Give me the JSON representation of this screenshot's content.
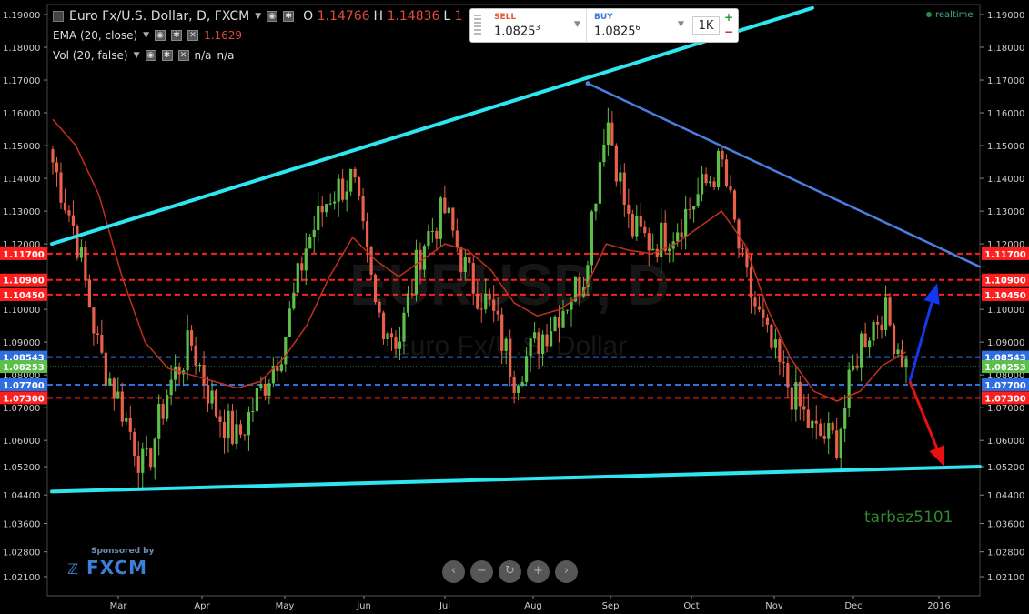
{
  "header": {
    "title": "Euro Fx/U.S. Dollar, D, FXCM",
    "ohlc": [
      {
        "key": "O",
        "value": "1.14766"
      },
      {
        "key": "H",
        "value": "1.14836"
      },
      {
        "key": "L",
        "value": "1"
      }
    ]
  },
  "indicators": {
    "ema_label": "EMA (20, close)",
    "ema_value": "1.1629",
    "vol_label": "Vol (20, false)",
    "vol_value1": "n/a",
    "vol_value2": "n/a"
  },
  "trade": {
    "sell_label": "SELL",
    "sell_price": "1.0825",
    "sell_pip": "3",
    "buy_label": "BUY",
    "buy_price": "1.0825",
    "buy_pip": "6",
    "quantity": "1K",
    "plus": "+",
    "minus": "−"
  },
  "status": {
    "realtime": "realtime"
  },
  "sponsor": {
    "label": "Sponsored by",
    "brand": "FXCM"
  },
  "watermark": {
    "line1": "EURUSD, D",
    "line2": "Euro Fx/U.S. Dollar"
  },
  "signature": "tarbaz5101",
  "nav_icons": [
    "chevron-left-icon",
    "zoom-out-icon",
    "reset-icon",
    "zoom-in-icon",
    "chevron-right-icon"
  ],
  "colors": {
    "up": "#5cbf4a",
    "down": "#e8604a",
    "ema": "#c0301e",
    "trendline": "#2ee6f0",
    "resistance_line": "#4a7fe0",
    "level_red": "#ff1f1f",
    "level_blue": "#2f6ee0"
  },
  "chart_data": {
    "type": "candlestick",
    "symbol": "EURUSD",
    "timeframe": "D",
    "ylim": [
      1.016,
      1.192
    ],
    "y_ticks": [
      "1.19000",
      "1.18000",
      "1.17000",
      "1.16000",
      "1.15000",
      "1.14000",
      "1.13000",
      "1.12000",
      "1.11000",
      "1.10000",
      "1.09000",
      "1.08000",
      "1.07000",
      "1.06000",
      "1.05200",
      "1.04400",
      "1.03600",
      "1.02800",
      "1.02100"
    ],
    "x_ticks": [
      "Mar",
      "Apr",
      "May",
      "Jun",
      "Jul",
      "Aug",
      "Sep",
      "Oct",
      "Nov",
      "Dec",
      "2016"
    ],
    "price_path": [
      [
        "Feb",
        1.145
      ],
      [
        "Mar",
        1.123
      ],
      [
        "Mar",
        1.087
      ],
      [
        "Mar",
        1.07
      ],
      [
        "Mar",
        1.05
      ],
      [
        "Apr",
        1.076
      ],
      [
        "Apr",
        1.09
      ],
      [
        "Apr",
        1.07
      ],
      [
        "Apr",
        1.06
      ],
      [
        "Apr",
        1.075
      ],
      [
        "May",
        1.09
      ],
      [
        "May",
        1.12
      ],
      [
        "May",
        1.135
      ],
      [
        "May",
        1.14
      ],
      [
        "Jun",
        1.1
      ],
      [
        "Jun",
        1.09
      ],
      [
        "Jun",
        1.12
      ],
      [
        "Jun",
        1.13
      ],
      [
        "Jul",
        1.11
      ],
      [
        "Jul",
        1.1
      ],
      [
        "Jul",
        1.08
      ],
      [
        "Aug",
        1.09
      ],
      [
        "Aug",
        1.1
      ],
      [
        "Aug",
        1.11
      ],
      [
        "Aug",
        1.16
      ],
      [
        "Sep",
        1.125
      ],
      [
        "Sep",
        1.12
      ],
      [
        "Sep",
        1.125
      ],
      [
        "Oct",
        1.135
      ],
      [
        "Oct",
        1.145
      ],
      [
        "Oct",
        1.11
      ],
      [
        "Nov",
        1.09
      ],
      [
        "Nov",
        1.075
      ],
      [
        "Nov",
        1.062
      ],
      [
        "Dec",
        1.06
      ],
      [
        "Dec",
        1.09
      ],
      [
        "Dec",
        1.1
      ],
      [
        "Dec",
        1.083
      ]
    ],
    "ema_path": [
      1.158,
      1.15,
      1.135,
      1.11,
      1.09,
      1.082,
      1.08,
      1.078,
      1.076,
      1.078,
      1.085,
      1.095,
      1.11,
      1.122,
      1.115,
      1.11,
      1.115,
      1.12,
      1.118,
      1.112,
      1.102,
      1.098,
      1.1,
      1.105,
      1.12,
      1.118,
      1.117,
      1.12,
      1.125,
      1.13,
      1.12,
      1.1,
      1.085,
      1.075,
      1.072,
      1.075,
      1.083,
      1.087
    ],
    "levels": [
      {
        "value": "1.11700",
        "y": 1.117,
        "color": "red"
      },
      {
        "value": "1.10900",
        "y": 1.109,
        "color": "red"
      },
      {
        "value": "1.10450",
        "y": 1.1045,
        "color": "red"
      },
      {
        "value": "1.08543",
        "y": 1.08543,
        "color": "blue"
      },
      {
        "value": "1.08253",
        "y": 1.08253,
        "color": "green"
      },
      {
        "value": "1.07700",
        "y": 1.077,
        "color": "blue"
      },
      {
        "value": "1.07300",
        "y": 1.073,
        "color": "red"
      }
    ],
    "trendlines": [
      {
        "name": "upper-support",
        "from": [
          "Feb",
          1.12
        ],
        "to": [
          "Dec",
          1.192
        ]
      },
      {
        "name": "lower-support",
        "from": [
          "Feb",
          1.045
        ],
        "to": [
          "2016+",
          1.052
        ]
      },
      {
        "name": "descending-resistance",
        "from": [
          "Aug",
          1.169
        ],
        "to": [
          "2016+",
          1.113
        ]
      }
    ],
    "arrows": [
      {
        "name": "up-arrow",
        "from": 1.078,
        "to": 1.108,
        "color": "blue"
      },
      {
        "name": "down-arrow",
        "from": 1.078,
        "to": 1.052,
        "color": "red"
      }
    ],
    "grid": false
  }
}
